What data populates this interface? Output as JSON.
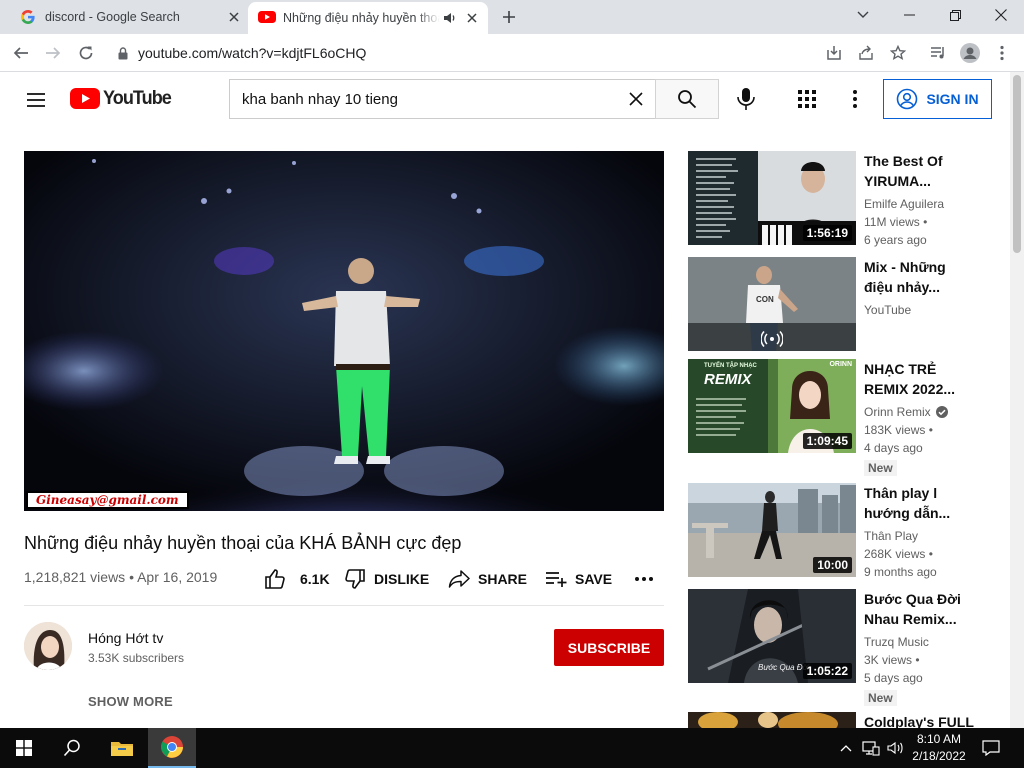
{
  "browser": {
    "tabs": [
      {
        "title": "discord - Google Search",
        "favicon": "google-icon"
      },
      {
        "title": "Những điệu nhảy huyền thoại",
        "favicon": "youtube-icon",
        "audio": "speaker-icon"
      }
    ],
    "url": "youtube.com/watch?v=kdjtFL6oCHQ"
  },
  "youtube": {
    "search_query": "kha banh nhay 10 tieng",
    "signin_label": "SIGN IN",
    "logo_text": "YouTube",
    "brand_color": "#ff0000",
    "link_color": "#065fd4"
  },
  "video": {
    "watermark": "Gineasay@gmail.com",
    "title": "Những điệu nhảy huyền thoại của KHÁ BẢNH cực đẹp",
    "stats": "1,218,821 views • Apr 16, 2019",
    "likes": "6.1K",
    "dislike_label": "DISLIKE",
    "share_label": "SHARE",
    "save_label": "SAVE",
    "channel_name": "Hóng Hớt tv",
    "subscribers": "3.53K subscribers",
    "subscribe_label": "SUBSCRIBE",
    "show_more_label": "SHOW MORE"
  },
  "recommendations": [
    {
      "title1": "The Best Of",
      "title2": "YIRUMA...",
      "channel": "Emilfe Aguilera",
      "views": "11M views •",
      "age": "6 years ago",
      "duration": "1:56:19",
      "verified": false,
      "badge": ""
    },
    {
      "title1": "Mix - Những",
      "title2": "điệu nhảy...",
      "channel": "YouTube",
      "views": "",
      "age": "",
      "duration": "",
      "verified": false,
      "badge": ""
    },
    {
      "title1": "NHẠC TRẺ",
      "title2": "REMIX 2022...",
      "channel": "Orinn Remix",
      "views": "183K views •",
      "age": "4 days ago",
      "duration": "1:09:45",
      "verified": true,
      "badge": "New"
    },
    {
      "title1": "Thân play l",
      "title2": "hướng dẫn...",
      "channel": "Thân Play",
      "views": "268K views •",
      "age": "9 months ago",
      "duration": "10:00",
      "verified": false,
      "badge": ""
    },
    {
      "title1": "Bước Qua Đời",
      "title2": "Nhau Remix...",
      "channel": "Truzq Music",
      "views": "3K views •",
      "age": "5 days ago",
      "duration": "1:05:22",
      "verified": false,
      "badge": "New"
    },
    {
      "title1": "Coldplay's FULL",
      "title2": "",
      "channel": "",
      "views": "",
      "age": "",
      "duration": "",
      "verified": false,
      "badge": ""
    }
  ],
  "thumb_text": {
    "con": "CON",
    "remix_small": "TUYỂN TẬP NHẠC",
    "remix_big": "REMIX",
    "orinn": "ORINN",
    "buoc": "Bước Qua Đời"
  },
  "taskbar": {
    "time": "8:10 AM",
    "date": "2/18/2022"
  }
}
